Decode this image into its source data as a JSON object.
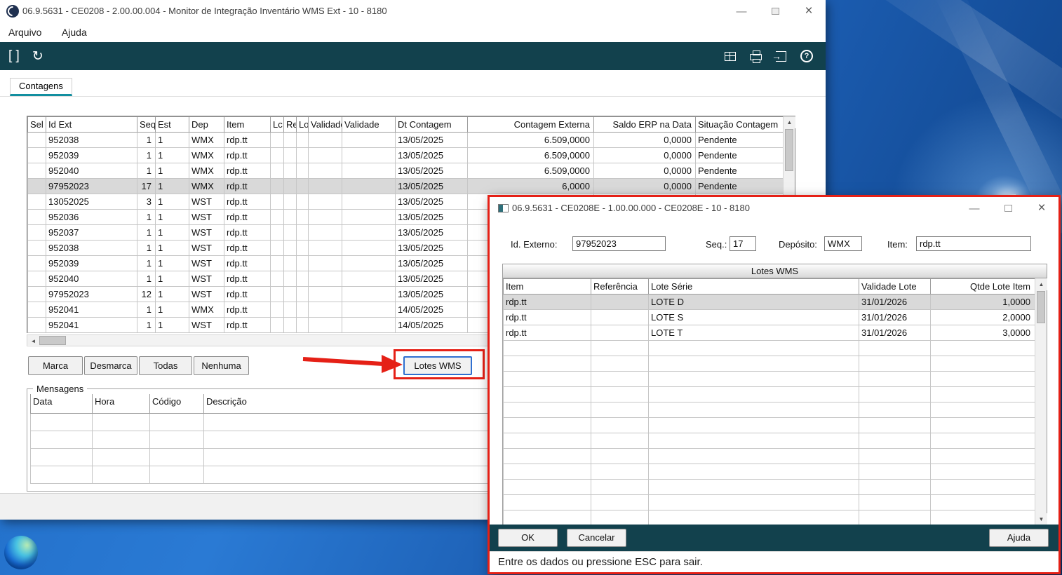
{
  "colors": {
    "toolbar": "#12414d",
    "tab_underline": "#128fa0",
    "selection": "#d9d9d9",
    "annotation": "#e52016"
  },
  "main_window": {
    "title": "06.9.5631 - CE0208 - 2.00.00.004 - Monitor de Integração Inventário WMS Ext - 10 - 8180",
    "controls": {
      "minimize": "—",
      "close": "×"
    },
    "menu": [
      "Arquivo",
      "Ajuda"
    ],
    "toolbar": {
      "brackets_glyph": "[ ]",
      "refresh_glyph": "↻",
      "help_glyph": "?"
    },
    "tab": "Contagens",
    "table": {
      "columns": [
        "Sel",
        "Id Ext",
        "Seq",
        "Est",
        "Dep",
        "Item",
        "Lc",
        "Re:",
        "Lo",
        "Validade '",
        "Validade",
        "Dt Contagem",
        "Contagem Externa",
        "Saldo ERP na Data",
        "Situação Contagem"
      ],
      "rows": [
        {
          "cells": [
            "",
            "952038",
            "1",
            "1",
            "WMX",
            "rdp.tt",
            "",
            "",
            "",
            "",
            "",
            "13/05/2025",
            "6.509,0000",
            "0,0000",
            "Pendente"
          ]
        },
        {
          "cells": [
            "",
            "952039",
            "1",
            "1",
            "WMX",
            "rdp.tt",
            "",
            "",
            "",
            "",
            "",
            "13/05/2025",
            "6.509,0000",
            "0,0000",
            "Pendente"
          ]
        },
        {
          "cells": [
            "",
            "952040",
            "1",
            "1",
            "WMX",
            "rdp.tt",
            "",
            "",
            "",
            "",
            "",
            "13/05/2025",
            "6.509,0000",
            "0,0000",
            "Pendente"
          ]
        },
        {
          "cells": [
            "",
            "97952023",
            "17",
            "1",
            "WMX",
            "rdp.tt",
            "",
            "",
            "",
            "",
            "",
            "13/05/2025",
            "6,0000",
            "0,0000",
            "Pendente"
          ],
          "selected": true
        },
        {
          "cells": [
            "",
            "13052025",
            "3",
            "1",
            "WST",
            "rdp.tt",
            "",
            "",
            "",
            "",
            "",
            "13/05/2025",
            "",
            "",
            ""
          ]
        },
        {
          "cells": [
            "",
            "952036",
            "1",
            "1",
            "WST",
            "rdp.tt",
            "",
            "",
            "",
            "",
            "",
            "13/05/2025",
            "",
            "",
            ""
          ]
        },
        {
          "cells": [
            "",
            "952037",
            "1",
            "1",
            "WST",
            "rdp.tt",
            "",
            "",
            "",
            "",
            "",
            "13/05/2025",
            "",
            "",
            ""
          ]
        },
        {
          "cells": [
            "",
            "952038",
            "1",
            "1",
            "WST",
            "rdp.tt",
            "",
            "",
            "",
            "",
            "",
            "13/05/2025",
            "",
            "",
            ""
          ]
        },
        {
          "cells": [
            "",
            "952039",
            "1",
            "1",
            "WST",
            "rdp.tt",
            "",
            "",
            "",
            "",
            "",
            "13/05/2025",
            "",
            "",
            ""
          ]
        },
        {
          "cells": [
            "",
            "952040",
            "1",
            "1",
            "WST",
            "rdp.tt",
            "",
            "",
            "",
            "",
            "",
            "13/05/2025",
            "",
            "",
            ""
          ]
        },
        {
          "cells": [
            "",
            "97952023",
            "12",
            "1",
            "WST",
            "rdp.tt",
            "",
            "",
            "",
            "",
            "",
            "13/05/2025",
            "",
            "",
            ""
          ]
        },
        {
          "cells": [
            "",
            "952041",
            "1",
            "1",
            "WMX",
            "rdp.tt",
            "",
            "",
            "",
            "",
            "",
            "14/05/2025",
            "",
            "",
            ""
          ]
        },
        {
          "cells": [
            "",
            "952041",
            "1",
            "1",
            "WST",
            "rdp.tt",
            "",
            "",
            "",
            "",
            "",
            "14/05/2025",
            "",
            "",
            ""
          ]
        }
      ]
    },
    "action_buttons": {
      "marca": "Marca",
      "desmarca": "Desmarca",
      "todas": "Todas",
      "nenhuma": "Nenhuma",
      "lotes_wms": "Lotes WMS"
    },
    "mensagens": {
      "legend": "Mensagens",
      "columns": [
        "Data",
        "Hora",
        "Código",
        "Descrição"
      ],
      "rows": []
    }
  },
  "dialog": {
    "title": "06.9.5631 - CE0208E - 1.00.00.000 - CE0208E - 10 - 8180",
    "controls": {
      "minimize": "—",
      "close": "×"
    },
    "fields": [
      {
        "label": "Id. Externo:",
        "value": "97952023"
      },
      {
        "label": "Seq.:",
        "value": "17"
      },
      {
        "label": "Depósito:",
        "value": "WMX"
      },
      {
        "label": "Item:",
        "value": "rdp.tt"
      }
    ],
    "table": {
      "group_header": "Lotes WMS",
      "columns": [
        "Item",
        "Referência",
        "Lote Série",
        "Validade Lote",
        "Qtde Lote Item"
      ],
      "rows": [
        {
          "cells": [
            "rdp.tt",
            "",
            "LOTE D",
            "31/01/2026",
            "1,0000"
          ],
          "selected": true
        },
        {
          "cells": [
            "rdp.tt",
            "",
            "LOTE S",
            "31/01/2026",
            "2,0000"
          ]
        },
        {
          "cells": [
            "rdp.tt",
            "",
            "LOTE T",
            "31/01/2026",
            "3,0000"
          ]
        }
      ]
    },
    "buttons": {
      "ok": "OK",
      "cancelar": "Cancelar",
      "ajuda": "Ajuda"
    },
    "status": "Entre os dados ou pressione ESC para sair."
  }
}
